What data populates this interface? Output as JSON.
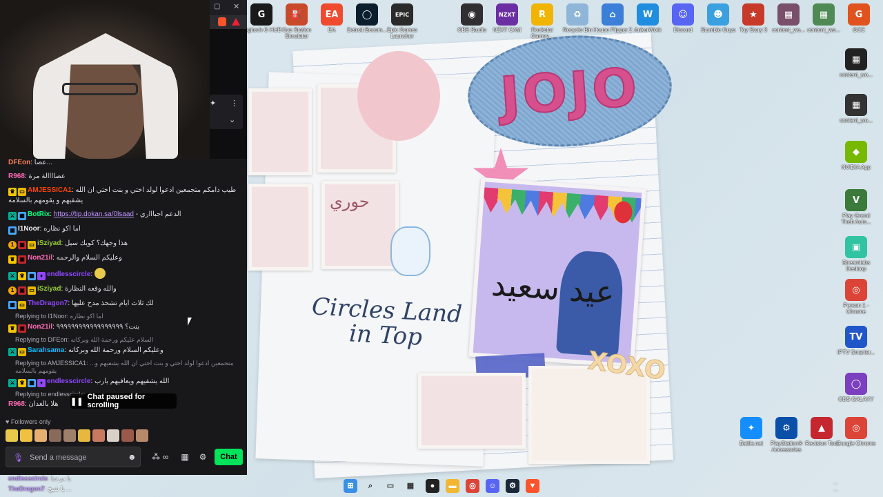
{
  "desktop": {
    "wallpaper": {
      "jojo": "JOJO",
      "hooori": "حوري",
      "eid": "عيد سعيد",
      "circles_land": "Circles Land in Top",
      "xoxo": "XOXO"
    },
    "icons_top": [
      {
        "name": "Logitech G HUB",
        "icon": "logitech-icon",
        "color": "#1a1a1a",
        "glyph": "G"
      },
      {
        "name": "Gas Station Simulator",
        "icon": "gas-station-icon",
        "color": "#c84a2a",
        "glyph": "⛽"
      },
      {
        "name": "EA",
        "icon": "ea-icon",
        "color": "#f04a2f",
        "glyph": "EA"
      },
      {
        "name": "Detroit Becom...",
        "icon": "detroit-icon",
        "color": "#0b1e2e",
        "glyph": "◯"
      },
      {
        "name": "Epic Games Launcher",
        "icon": "epic-games-icon",
        "color": "#2a2a2a",
        "glyph": "EPIC"
      },
      {
        "name": "OBS Studio",
        "icon": "obs-icon",
        "color": "#302e31",
        "glyph": "◉"
      },
      {
        "name": "NZXT CAM",
        "icon": "nzxt-icon",
        "color": "#6b2fa3",
        "glyph": "NZXT"
      },
      {
        "name": "Rockstar Games...",
        "icon": "rockstar-icon",
        "color": "#f1b400",
        "glyph": "R"
      },
      {
        "name": "Recycle Bin",
        "icon": "recycle-bin-icon",
        "color": "#8fb6d8",
        "glyph": "♻"
      },
      {
        "name": "House Flipper 2",
        "icon": "house-flipper-icon",
        "color": "#3b7fd8",
        "glyph": "⌂"
      },
      {
        "name": "AnkerWork",
        "icon": "ankerwork-icon",
        "color": "#1f8de0",
        "glyph": "W"
      },
      {
        "name": "Discord",
        "icon": "discord-icon",
        "color": "#5865f2",
        "glyph": "☺"
      },
      {
        "name": "Stumble Guys",
        "icon": "stumble-guys-icon",
        "color": "#3aa0e0",
        "glyph": "☻"
      },
      {
        "name": "Toy Story 3",
        "icon": "toy-story-icon",
        "color": "#c73a2a",
        "glyph": "★"
      },
      {
        "name": "content_wo...",
        "icon": "content-file-icon",
        "color": "#7a4f6a",
        "glyph": "▦"
      },
      {
        "name": "content_wo...",
        "icon": "content-file-icon",
        "color": "#4f8a55",
        "glyph": "▦"
      },
      {
        "name": "GCC",
        "icon": "gcc-icon",
        "color": "#e0531f",
        "glyph": "G"
      }
    ],
    "icons_right": [
      {
        "name": "content_wo...",
        "icon": "content-file-icon",
        "color": "#222",
        "glyph": "▦"
      },
      {
        "name": "content_wo...",
        "icon": "content-file-icon",
        "color": "#333",
        "glyph": "▦"
      },
      {
        "name": "NVIDIA App",
        "icon": "nvidia-icon",
        "color": "#76b900",
        "glyph": "◆"
      },
      {
        "name": "Play Grand Theft Auto...",
        "icon": "gta-icon",
        "color": "#3a7a3a",
        "glyph": "V"
      },
      {
        "name": "Streamlabs Desktop",
        "icon": "streamlabs-icon",
        "color": "#31c3a2",
        "glyph": "▣"
      },
      {
        "name": "Person 1 - Chrome",
        "icon": "chrome-icon",
        "color": "#db4437",
        "glyph": "◎"
      },
      {
        "name": "IPTV Smarter...",
        "icon": "iptv-icon",
        "color": "#2156c9",
        "glyph": "TV"
      },
      {
        "name": "OBS GALAXY",
        "icon": "obs-galaxy-icon",
        "color": "#7b3fbf",
        "glyph": "◯"
      }
    ],
    "icons_bottom": [
      {
        "name": "Battle.net",
        "icon": "battlenet-icon",
        "color": "#148eff",
        "glyph": "✦"
      },
      {
        "name": "PlayStation® Accessories",
        "icon": "playstation-icon",
        "color": "#0a4fa8",
        "glyph": "⚙"
      },
      {
        "name": "Revision Tool",
        "icon": "revision-tool-icon",
        "color": "#c6262e",
        "glyph": "▲"
      },
      {
        "name": "Google Chrome",
        "icon": "chrome-icon",
        "color": "#db4437",
        "glyph": "◎"
      }
    ]
  },
  "chat": {
    "messages": [
      {
        "badges": [],
        "user": "DFEon",
        "color": "#ff7f50",
        "text": "عصا...",
        "reply": null
      },
      {
        "badges": [],
        "user": "R968",
        "color": "#ff69b4",
        "text": "عصاااالة مرة",
        "reply": null
      },
      {
        "badges": [
          "crown",
          "sub"
        ],
        "user": "AMJESSICA1",
        "color": "#ff4500",
        "text": "طيب دامكم متجمعين ادعوا لولد اختي و بنت اختي ان الله يشفيهم و يقومهم بالسلامه",
        "reply": null
      },
      {
        "badges": [
          "bot",
          "vip"
        ],
        "user": "BotRix",
        "color": "#00ff7f",
        "link": "https://tip.dokan.sa/0lsaad",
        "text": "- الدعم اجباااري",
        "reply": null
      },
      {
        "badges": [
          "vip"
        ],
        "user": "I1Noor",
        "color": "#efeff1",
        "text": "اما اكو نظاره",
        "reply": null
      },
      {
        "badges": [
          "num",
          "gift",
          "sub"
        ],
        "user": "iSziyad",
        "color": "#9acd32",
        "text": "هذا وجهك؟ كويك سيل",
        "reply": null
      },
      {
        "badges": [
          "crown",
          "gift"
        ],
        "user": "Non21il",
        "color": "#ff69b4",
        "text": "وعليكم السلام والرحمه",
        "reply": null
      },
      {
        "badges": [
          "bot",
          "crown",
          "vip",
          "prime"
        ],
        "user": "endlesscircle",
        "color": "#9147ff",
        "text": "",
        "reply": null
      },
      {
        "badges": [
          "num",
          "gift",
          "sub"
        ],
        "user": "iSziyad",
        "color": "#9acd32",
        "text": "والله وقعه النظارة",
        "reply": null
      },
      {
        "badges": [
          "vip",
          "sub"
        ],
        "user": "TheDragon7",
        "color": "#9147ff",
        "text": "لك ثلاث ايام تشحذ مدح عليها",
        "reply": null
      },
      {
        "badges": [
          "crown",
          "gift"
        ],
        "user": "Non21il",
        "color": "#ff69b4",
        "text": "بنت؟ ٩٩٩٩٩٩٩٩٩٩٩٩٩٩٩٩٩٩",
        "reply": {
          "to": "Replying to I1Noor:",
          "text": "اما اكو نظاره"
        }
      },
      {
        "badges": [
          "bot",
          "sub"
        ],
        "user": "Sarahsama",
        "color": "#00bfff",
        "text": "وعليكم السلام ورحمة الله وبركاته",
        "reply": {
          "to": "Replying to DFEon:",
          "text": "السلام عليكم ورحمة الله وبركاته"
        }
      },
      {
        "badges": [
          "bot",
          "crown",
          "vip",
          "prime"
        ],
        "user": "endlesscircle",
        "color": "#9147ff",
        "text": "الله يشفيهم ويعافيهم يارب",
        "reply": {
          "to": "Replying to AMJESSICA1:",
          "text": "...متجمعين ادعوا لولد اختي و بنت اختي ان الله يشفيهم و يقومهم بالسلامه"
        }
      },
      {
        "badges": [],
        "user": "R968",
        "color": "#ff69b4",
        "text": "هلا بالغدان",
        "reply": {
          "to": "Replying to endlesscircle:",
          "text": ""
        }
      }
    ],
    "paused_label": "Chat paused for scrolling",
    "followers_only": "Followers only",
    "input_placeholder": "Send a message",
    "send_label": "Chat",
    "ghost_lines": [
      {
        "user": "endlesscircle",
        "text": "يا مرحبا"
      },
      {
        "user": "TheDragon7",
        "text": "يا شيخ ..."
      }
    ]
  },
  "taskbar": {
    "icons": [
      {
        "name": "start",
        "icon": "windows-start-icon",
        "color": "#3a8ee6",
        "glyph": "⊞"
      },
      {
        "name": "search",
        "icon": "search-icon",
        "color": "transparent",
        "glyph": "⌕"
      },
      {
        "name": "task view",
        "icon": "task-view-icon",
        "color": "transparent",
        "glyph": "▭"
      },
      {
        "name": "widgets",
        "icon": "widgets-icon",
        "color": "transparent",
        "glyph": "▦"
      },
      {
        "name": "app",
        "icon": "app-icon",
        "color": "#222",
        "glyph": "●"
      },
      {
        "name": "file explorer",
        "icon": "file-explorer-icon",
        "color": "#f2b632",
        "glyph": "▬"
      },
      {
        "name": "chrome",
        "icon": "chrome-icon",
        "color": "#db4437",
        "glyph": "◎"
      },
      {
        "name": "discord",
        "icon": "discord-icon",
        "color": "#5865f2",
        "glyph": "☺"
      },
      {
        "name": "steam",
        "icon": "steam-icon",
        "color": "#1b2838",
        "glyph": "⚙"
      },
      {
        "name": "brave",
        "icon": "brave-icon",
        "color": "#fb542b",
        "glyph": "▼"
      }
    ],
    "time": "...",
    "date": "..."
  }
}
